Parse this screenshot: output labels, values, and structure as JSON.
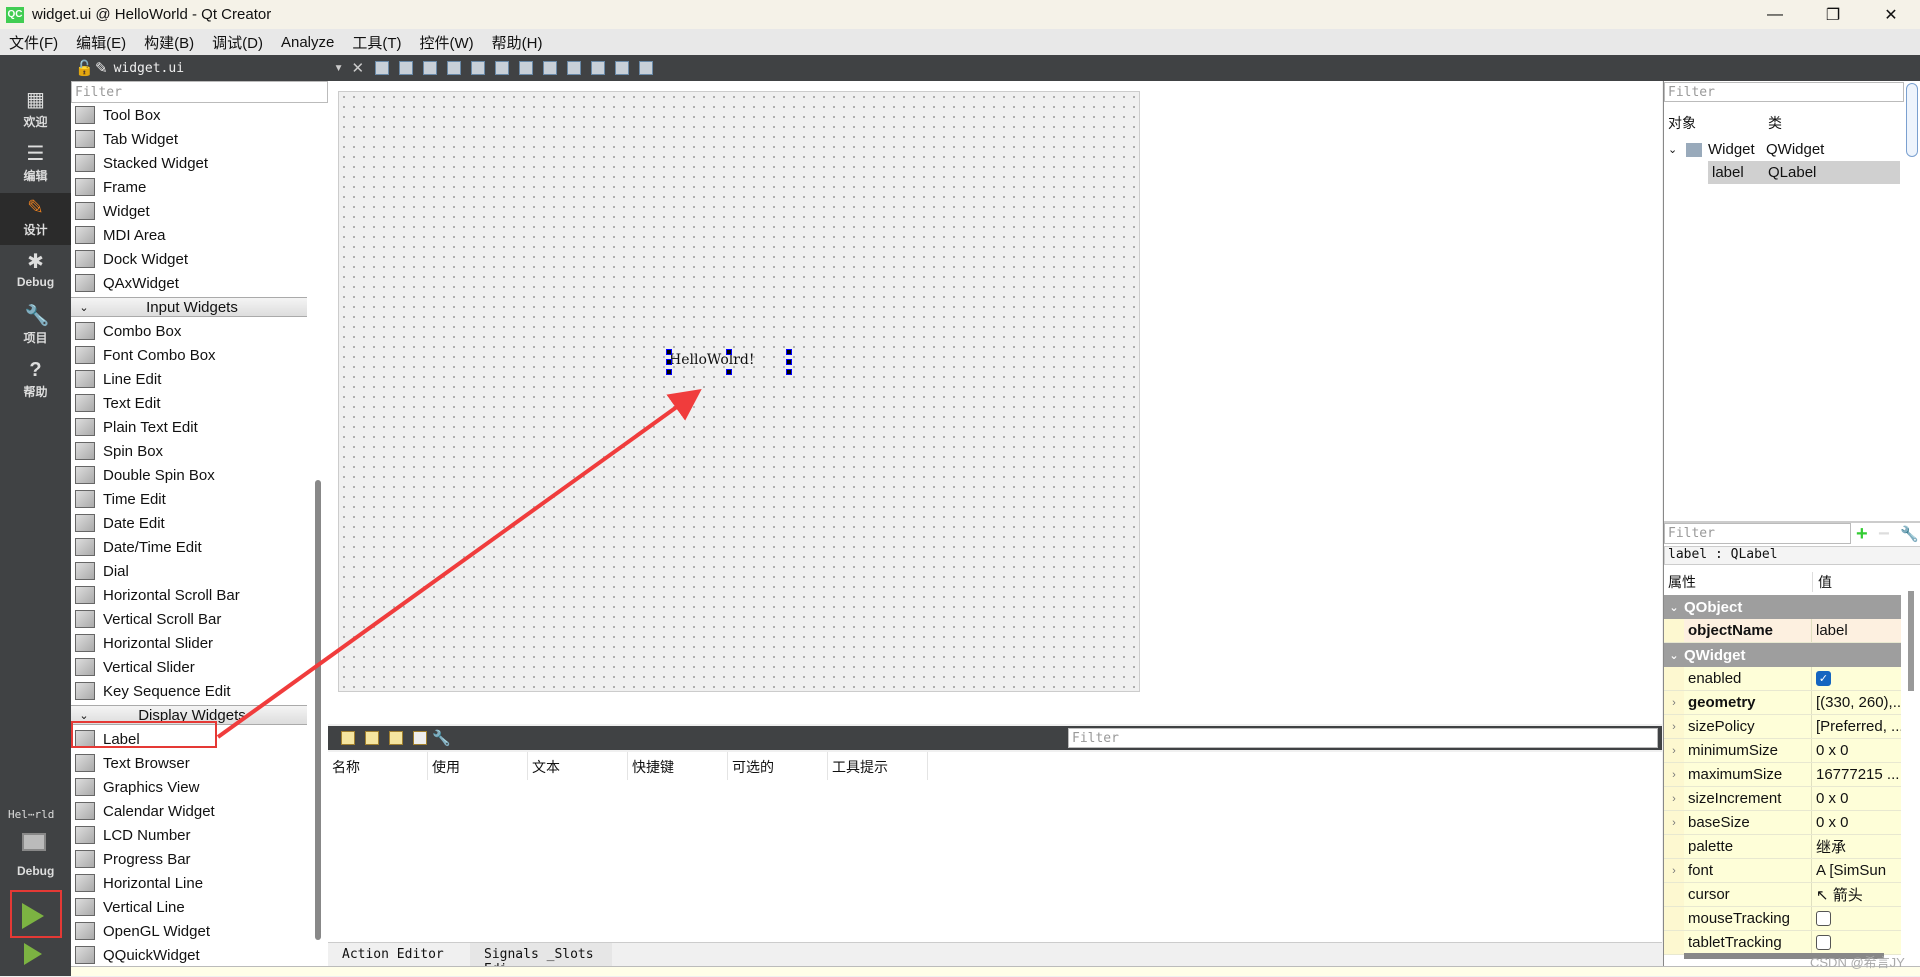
{
  "window": {
    "title": "widget.ui @ HelloWorld - Qt Creator",
    "app_icon": "QC",
    "controls": [
      "—",
      "❐",
      "✕"
    ]
  },
  "menu": [
    "文件(F)",
    "编辑(E)",
    "构建(B)",
    "调试(D)",
    "Analyze",
    "工具(T)",
    "控件(W)",
    "帮助(H)"
  ],
  "toolbar": {
    "file_name": "widget.ui",
    "close": "✕"
  },
  "modes": [
    {
      "label": "欢迎",
      "icon": "grid-icon",
      "glyph": "▦"
    },
    {
      "label": "编辑",
      "icon": "document-icon",
      "glyph": "☰"
    },
    {
      "label": "设计",
      "icon": "pencil-icon",
      "glyph": "✎",
      "active": true
    },
    {
      "label": "Debug",
      "icon": "bug-icon",
      "glyph": "✱"
    },
    {
      "label": "项目",
      "icon": "wrench-icon",
      "glyph": "🔧"
    },
    {
      "label": "帮助",
      "icon": "help-icon",
      "glyph": "?"
    }
  ],
  "kit": {
    "project": "Hel⋯rld",
    "build": "Debug"
  },
  "widget_box": {
    "filter_placeholder": "Filter",
    "rows": [
      {
        "t": "Tool Box"
      },
      {
        "t": "Tab Widget"
      },
      {
        "t": "Stacked Widget"
      },
      {
        "t": "Frame"
      },
      {
        "t": "Widget"
      },
      {
        "t": "MDI Area"
      },
      {
        "t": "Dock Widget"
      },
      {
        "t": "QAxWidget"
      },
      {
        "cat": "Input Widgets"
      },
      {
        "t": "Combo Box"
      },
      {
        "t": "Font Combo Box"
      },
      {
        "t": "Line Edit"
      },
      {
        "t": "Text Edit"
      },
      {
        "t": "Plain Text Edit"
      },
      {
        "t": "Spin Box"
      },
      {
        "t": "Double Spin Box"
      },
      {
        "t": "Time Edit"
      },
      {
        "t": "Date Edit"
      },
      {
        "t": "Date/Time Edit"
      },
      {
        "t": "Dial"
      },
      {
        "t": "Horizontal Scroll Bar"
      },
      {
        "t": "Vertical Scroll Bar"
      },
      {
        "t": "Horizontal Slider"
      },
      {
        "t": "Vertical Slider"
      },
      {
        "t": "Key Sequence Edit"
      },
      {
        "cat": "Display Widgets"
      },
      {
        "t": "Label"
      },
      {
        "t": "Text Browser"
      },
      {
        "t": "Graphics View"
      },
      {
        "t": "Calendar Widget"
      },
      {
        "t": "LCD Number"
      },
      {
        "t": "Progress Bar"
      },
      {
        "t": "Horizontal Line"
      },
      {
        "t": "Vertical Line"
      },
      {
        "t": "OpenGL Widget"
      },
      {
        "t": "QQuickWidget"
      }
    ]
  },
  "form": {
    "label_text": "HelloWolrd!"
  },
  "action_editor": {
    "filter_placeholder": "Filter",
    "columns": [
      "名称",
      "使用",
      "文本",
      "快捷键",
      "可选的",
      "工具提示"
    ]
  },
  "bottom_tabs": [
    "Action Editor",
    "Signals _Slots Edi⋯"
  ],
  "object_inspector": {
    "filter_placeholder": "Filter",
    "columns": [
      "对象",
      "类"
    ],
    "rows": [
      {
        "object": "Widget",
        "class": "QWidget"
      },
      {
        "object": "label",
        "class": "QLabel"
      }
    ]
  },
  "property_editor": {
    "filter_placeholder": "Filter",
    "subject": "label : QLabel",
    "columns": [
      "属性",
      "值"
    ],
    "groups": [
      {
        "name": "QObject",
        "props": [
          {
            "n": "objectName",
            "v": "label",
            "bold": true
          }
        ]
      },
      {
        "name": "QWidget",
        "props": [
          {
            "n": "enabled",
            "check": true
          },
          {
            "n": "geometry",
            "v": "[(330, 260),...",
            "bold": true,
            "exp": true
          },
          {
            "n": "sizePolicy",
            "v": "[Preferred, ...",
            "exp": true
          },
          {
            "n": "minimumSize",
            "v": "0 x 0",
            "exp": true
          },
          {
            "n": "maximumSize",
            "v": "16777215 ...",
            "exp": true
          },
          {
            "n": "sizeIncrement",
            "v": "0 x 0",
            "exp": true
          },
          {
            "n": "baseSize",
            "v": "0 x 0",
            "exp": true
          },
          {
            "n": "palette",
            "v": "继承"
          },
          {
            "n": "font",
            "v": "A  [SimSun",
            "exp": true
          },
          {
            "n": "cursor",
            "v": "↖ 箭头"
          },
          {
            "n": "mouseTracking",
            "check": false
          },
          {
            "n": "tabletTracking",
            "check": false
          }
        ]
      }
    ]
  },
  "watermark": "CSDN @希言JY",
  "colors": {
    "accent_red": "#e53935",
    "dark_bar": "#404244",
    "run_green": "#7cb342"
  }
}
